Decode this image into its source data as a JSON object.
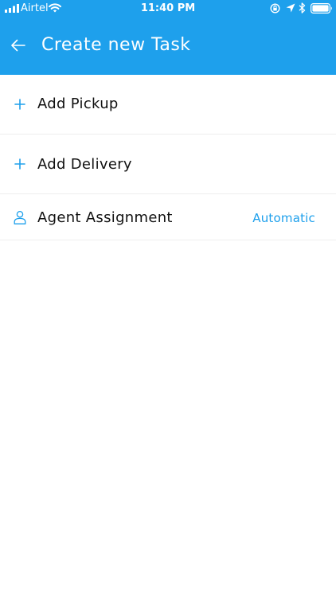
{
  "status_bar": {
    "carrier": "Airtel",
    "time": "11:40 PM"
  },
  "header": {
    "title": "Create new Task",
    "back_icon": "arrow-left-icon"
  },
  "rows": [
    {
      "icon": "plus-icon",
      "label": "Add Pickup"
    },
    {
      "icon": "plus-icon",
      "label": "Add Delivery"
    },
    {
      "icon": "person-icon",
      "label": "Agent Assignment",
      "value": "Automatic"
    }
  ],
  "colors": {
    "accent": "#1ea0ec",
    "text": "#111111",
    "divider": "#eeeeee",
    "background": "#ffffff"
  }
}
